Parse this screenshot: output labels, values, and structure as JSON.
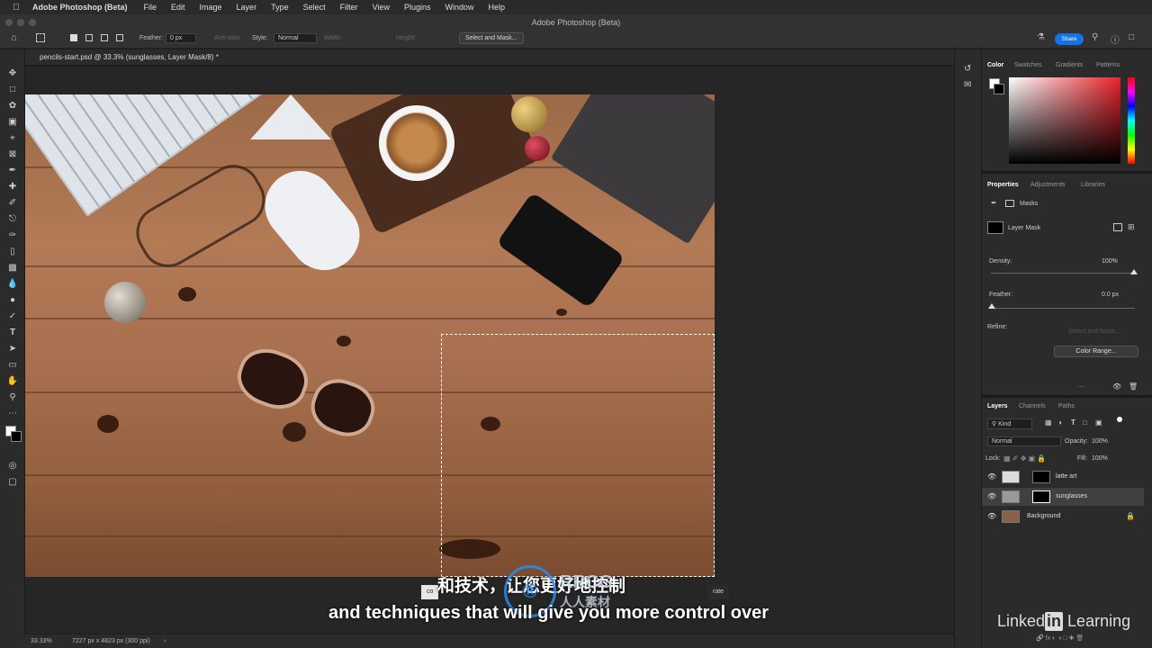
{
  "menubar": {
    "app": "Adobe Photoshop (Beta)",
    "items": [
      "File",
      "Edit",
      "Image",
      "Layer",
      "Type",
      "Select",
      "Filter",
      "View",
      "Plugins",
      "Window",
      "Help"
    ]
  },
  "window": {
    "title": "Adobe Photoshop (Beta)"
  },
  "options_bar": {
    "feather_label": "Feather:",
    "feather_value": "0 px",
    "antialias_label": "Anti-alias",
    "style_label": "Style:",
    "style_value": "Normal",
    "width_label": "Width:",
    "height_label": "Height:",
    "select_mask_button": "Select and Mask...",
    "share_button": "Share"
  },
  "document": {
    "tab_label": "pencils-start.psd @ 33.3% (sunglasses, Layer Mask/8) *"
  },
  "status": {
    "zoom": "33.33%",
    "info": "7227 px x 4823 px (300 ppi)"
  },
  "color_panel": {
    "tabs": [
      "Color",
      "Swatches",
      "Gradients",
      "Patterns"
    ],
    "active_tab": "Color"
  },
  "properties_panel": {
    "tabs": [
      "Properties",
      "Adjustments",
      "Libraries"
    ],
    "masks_label": "Masks",
    "layer_mask_label": "Layer Mask",
    "density_label": "Density:",
    "density_value": "100%",
    "feather_label": "Feather:",
    "feather_value": "0.0 px",
    "refine_label": "Refine:",
    "select_and_mask": "Select and Mask...",
    "color_range": "Color Range..."
  },
  "layers_panel": {
    "tabs": [
      "Layers",
      "Channels",
      "Paths"
    ],
    "kind_label": "Kind",
    "blend_mode": "Normal",
    "opacity_label": "Opacity:",
    "opacity_value": "100%",
    "lock_label": "Lock:",
    "fill_label": "Fill:",
    "fill_value": "100%",
    "layers": [
      {
        "name": "latte art",
        "selected": false
      },
      {
        "name": "sunglasses",
        "selected": true
      },
      {
        "name": "Background",
        "selected": false
      }
    ]
  },
  "subtitles": {
    "chinese": "和技术，让您更好地控制",
    "english": "and techniques that will give you more control over"
  },
  "branding": {
    "watermark": "RRCG",
    "watermark_sub": "人人素材",
    "linkedin_a": "Linked",
    "linkedin_in": "in",
    "linkedin_b": " Learning"
  },
  "tooltips": {
    "left": "co",
    "right": "rate"
  },
  "colors": {
    "accent": "#1473e6",
    "panel_bg": "#2b2b2b",
    "canvas_bg": "#262626"
  }
}
